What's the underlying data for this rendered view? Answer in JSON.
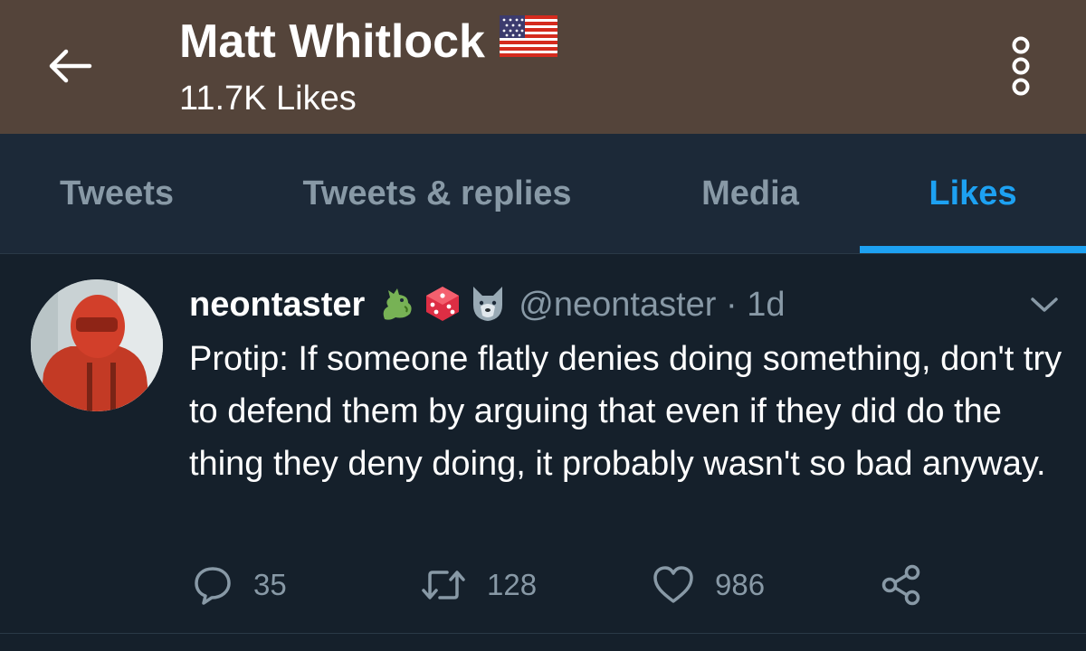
{
  "header": {
    "title": "Matt Whitlock",
    "subtitle": "11.7K Likes",
    "title_emoji": "us-flag"
  },
  "tabs": [
    {
      "label": "Tweets",
      "active": false
    },
    {
      "label": "Tweets & replies",
      "active": false
    },
    {
      "label": "Media",
      "active": false
    },
    {
      "label": "Likes",
      "active": true
    }
  ],
  "tweet": {
    "display_name": "neontaster",
    "name_emojis": [
      "dragon",
      "die",
      "wolf"
    ],
    "handle_meta": "@neontaster · 1d",
    "text": "Protip: If someone flatly denies doing something, don't try to defend them by arguing that even if they did do the thing they deny doing, it probably wasn't so bad anyway.",
    "actions": {
      "reply_count": "35",
      "retweet_count": "128",
      "like_count": "986"
    }
  },
  "colors": {
    "header_bg": "#54443a",
    "tabs_bg": "#1c2938",
    "page_bg": "#15202b",
    "accent": "#1da1f2",
    "muted": "#8899a6"
  },
  "icons": [
    "back-arrow-icon",
    "more-vertical-icon",
    "chevron-down-icon",
    "reply-icon",
    "retweet-icon",
    "heart-icon",
    "share-icon"
  ]
}
